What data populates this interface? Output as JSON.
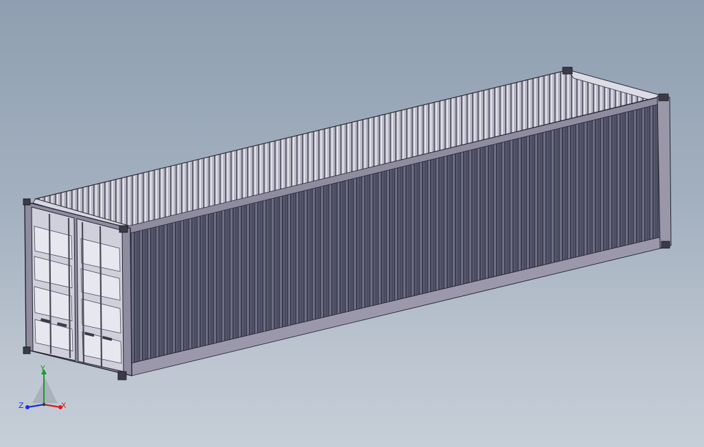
{
  "viewport": {
    "background_top": "#8f9fb1",
    "background_bottom": "#c6ced8"
  },
  "model": {
    "subject": "shipping-container",
    "body_color": "#55566c",
    "edge_color": "#23232f",
    "frame_color": "#9a97a8",
    "door_panel_color": "#dcdde6"
  },
  "triad": {
    "y_label": "Y",
    "x_label": "X",
    "z_label": "Z",
    "y_color": "#1a9a2a",
    "x_color": "#d42020",
    "z_color": "#1c2fd0"
  }
}
